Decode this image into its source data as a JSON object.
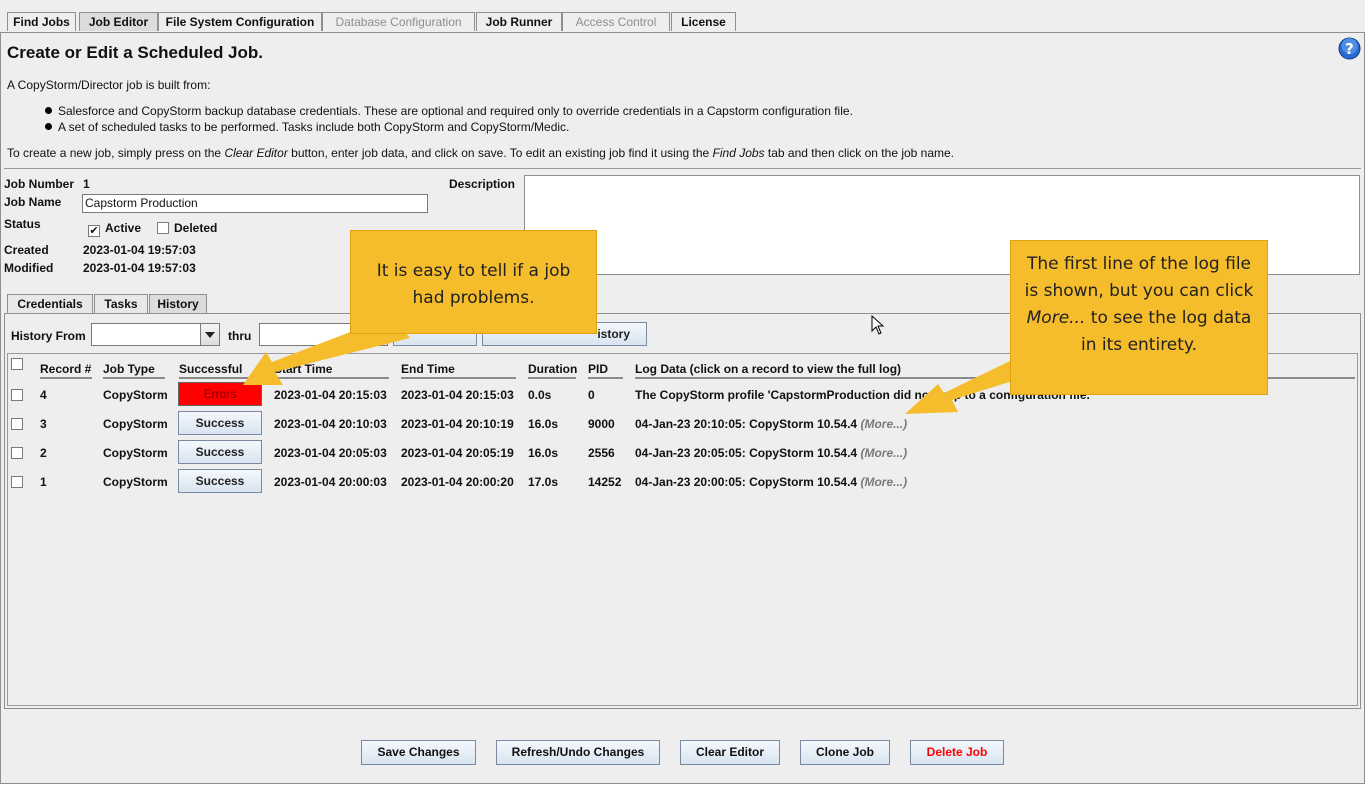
{
  "tabs": [
    "Find Jobs",
    "Job Editor",
    "File System Configuration",
    "Database Configuration",
    "Job Runner",
    "Access Control",
    "License"
  ],
  "page": {
    "title": "Create or Edit a Scheduled Job.",
    "intro": "A CopyStorm/Director job is built from:",
    "bullets": [
      "Salesforce and CopyStorm backup database credentials. These are optional and required only to override credentials in a Capstorm configuration file.",
      "A set of scheduled tasks to be performed. Tasks include both CopyStorm and CopyStorm/Medic."
    ],
    "instructions": {
      "p1": "To create a new job, simply press on the ",
      "em1": "Clear Editor",
      "p2": " button, enter job data, and click on save. To edit an existing job find it using the ",
      "em2": "Find Jobs",
      "p3": " tab and then click on the job name."
    }
  },
  "job": {
    "number_label": "Job Number",
    "number": "1",
    "name_label": "Job Name",
    "name": "Capstorm Production",
    "status_label": "Status",
    "active_label": "Active",
    "deleted_label": "Deleted",
    "active_checked": true,
    "deleted_checked": false,
    "created_label": "Created",
    "created": "2023-01-04 19:57:03",
    "modified_label": "Modified",
    "modified": "2023-01-04 19:57:03",
    "description_label": "Description",
    "description": ""
  },
  "subtabs": [
    "Credentials",
    "Tasks",
    "History"
  ],
  "history": {
    "from_label": "History From",
    "thru_label": "thru",
    "refresh_label": "istory",
    "columns": [
      "Record #",
      "Job Type",
      "Successful",
      "Start Time",
      "End Time",
      "Duration",
      "PID",
      "Log Data  (click on a record to view the full log)"
    ],
    "rows": [
      {
        "record": "4",
        "type": "CopyStorm",
        "status": "Errors",
        "start": "2023-01-04 20:15:03",
        "end": "2023-01-04 20:15:03",
        "duration": "0.0s",
        "pid": "0",
        "log": "The CopyStorm profile 'CapstormProduction did not map to a configuration file.",
        "more": ""
      },
      {
        "record": "3",
        "type": "CopyStorm",
        "status": "Success",
        "start": "2023-01-04 20:10:03",
        "end": "2023-01-04 20:10:19",
        "duration": "16.0s",
        "pid": "9000",
        "log": "04-Jan-23 20:10:05: CopyStorm 10.54.4",
        "more": "(More...)"
      },
      {
        "record": "2",
        "type": "CopyStorm",
        "status": "Success",
        "start": "2023-01-04 20:05:03",
        "end": "2023-01-04 20:05:19",
        "duration": "16.0s",
        "pid": "2556",
        "log": "04-Jan-23 20:05:05: CopyStorm 10.54.4",
        "more": "(More...)"
      },
      {
        "record": "1",
        "type": "CopyStorm",
        "status": "Success",
        "start": "2023-01-04 20:00:03",
        "end": "2023-01-04 20:00:20",
        "duration": "17.0s",
        "pid": "14252",
        "log": "04-Jan-23 20:00:05: CopyStorm 10.54.4",
        "more": "(More...)"
      }
    ]
  },
  "callouts": {
    "left": "It is easy to tell if a job had problems.",
    "right_a": "The first line of the log file is shown, but you can click ",
    "right_em": "More...",
    "right_b": " to see the log data in its entirety."
  },
  "buttons": [
    "Save Changes",
    "Refresh/Undo Changes",
    "Clear Editor",
    "Clone Job",
    "Delete Job"
  ],
  "colors": {
    "error": "#ff0000",
    "callout": "#f5bc2b",
    "delete_text": "#ff0000"
  }
}
